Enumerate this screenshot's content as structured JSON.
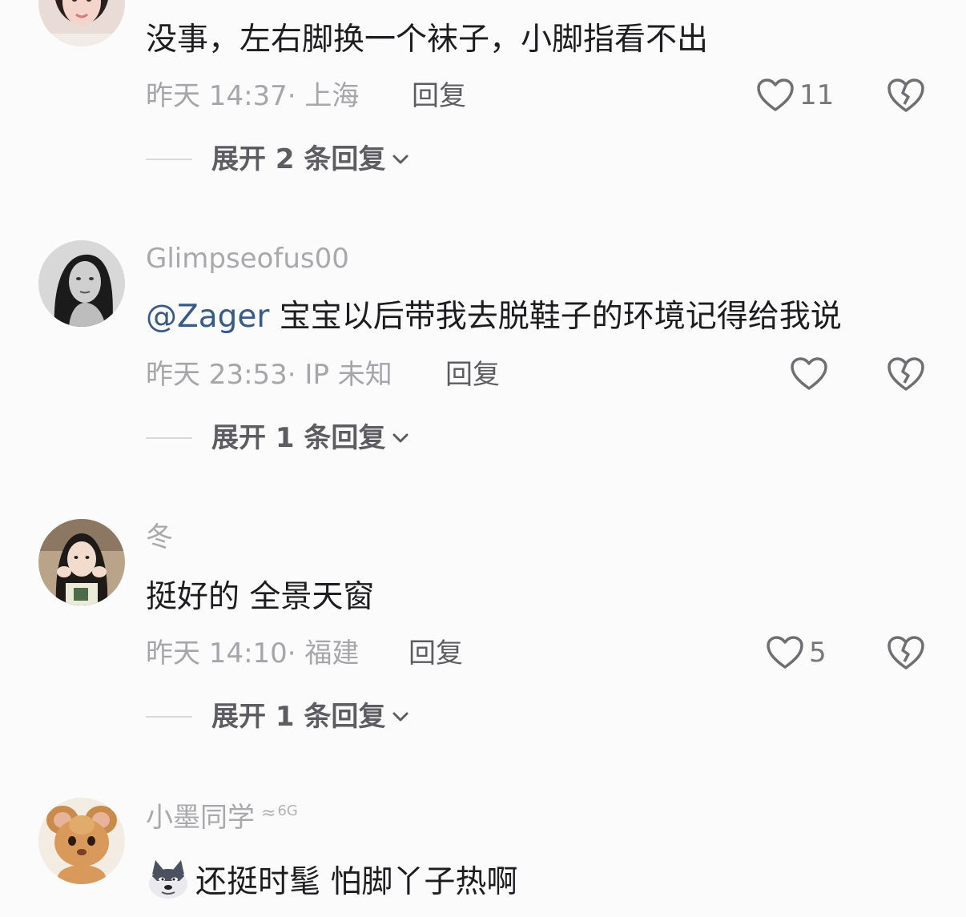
{
  "comments": [
    {
      "username": "",
      "text": "没事，左右脚换一个袜子，小脚指看不出",
      "time": "昨天 14:37",
      "location": "· 上海",
      "reply_label": "回复",
      "likes": "11",
      "expand_label": "展开 2 条回复"
    },
    {
      "username": "Glimpseofus00",
      "mention": "@Zager",
      "text": " 宝宝以后带我去脱鞋子的环境记得给我说",
      "time": "昨天 23:53",
      "location": "· IP 未知",
      "reply_label": "回复",
      "likes": "",
      "expand_label": "展开 1 条回复"
    },
    {
      "username": "冬",
      "text": "挺好的 全景天窗",
      "time": "昨天 14:10",
      "location": "· 福建",
      "reply_label": "回复",
      "likes": "5",
      "expand_label": "展开 1 条回复"
    },
    {
      "username": "小墨同学",
      "signal": "6G",
      "text": "还挺时髦 怕脚丫子热啊",
      "emoji": "dog-face-emoji"
    }
  ],
  "icons": {
    "like": "heart-outline-icon",
    "dislike": "broken-heart-icon",
    "expand": "chevron-down-icon"
  },
  "colors": {
    "text": "#1d1d1f",
    "meta": "#a6a6aa",
    "mention": "#385b86",
    "background": "#fbfbfb"
  }
}
